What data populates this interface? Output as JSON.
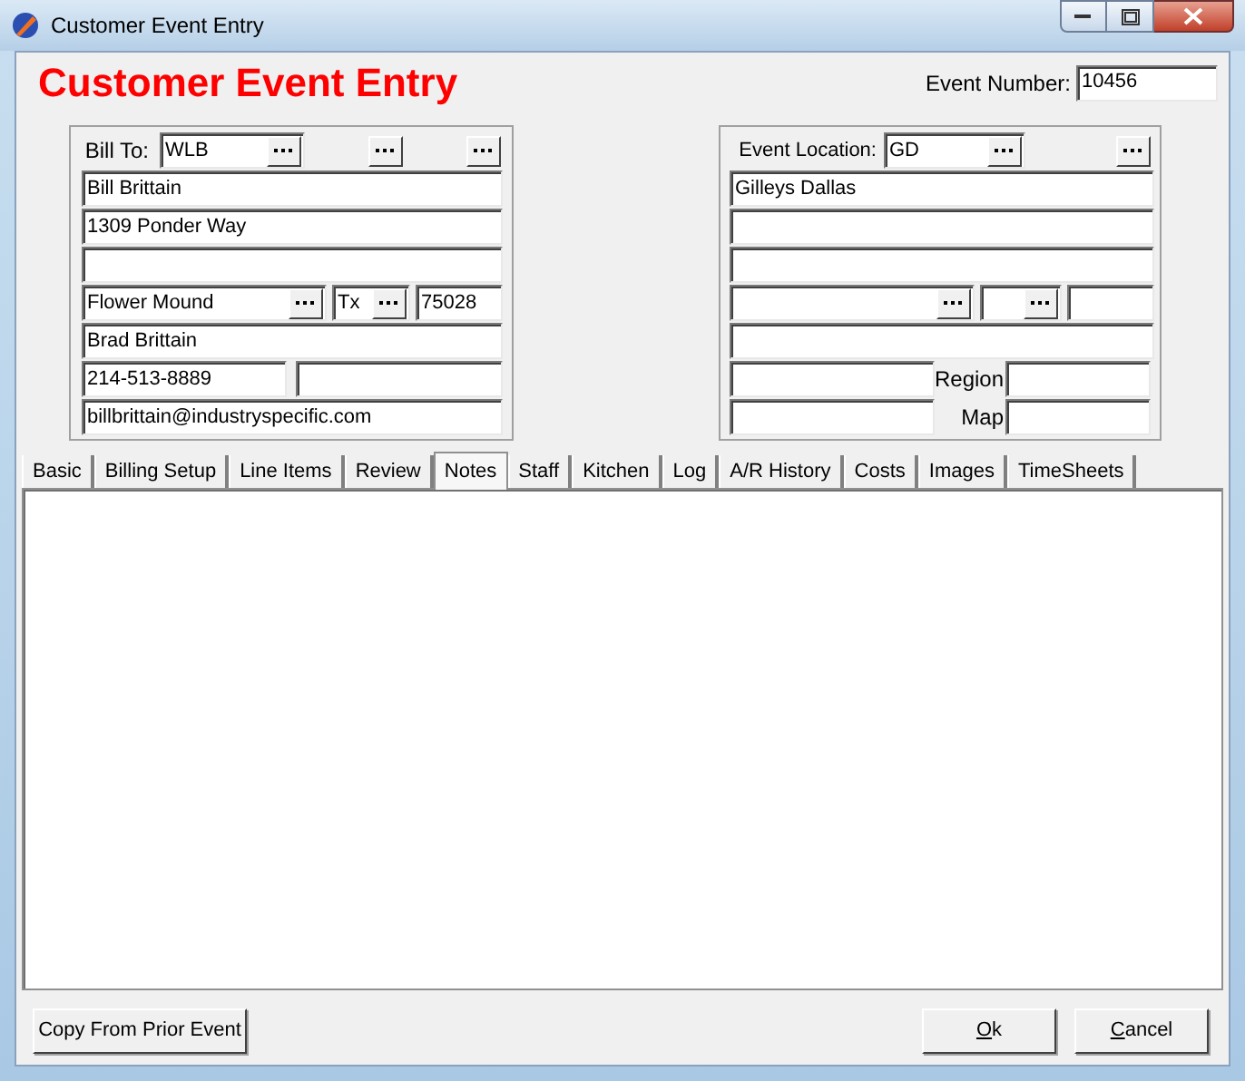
{
  "window": {
    "title": "Customer Event Entry"
  },
  "header": {
    "title": "Customer Event Entry",
    "event_number_label": "Event Number:",
    "event_number": "10456"
  },
  "bill_to": {
    "label": "Bill To:",
    "code": "WLB",
    "name": "Bill Brittain",
    "address": "1309 Ponder Way",
    "city": "Flower Mound",
    "state": "Tx",
    "zip": "75028",
    "contact": "Brad Brittain",
    "phone": "214-513-8889",
    "email": "billbrittain@industryspecific.com"
  },
  "event_location": {
    "label": "Event Location:",
    "code": "GD",
    "name": "Gilleys Dallas",
    "region_label": "Region",
    "map_label": "Map"
  },
  "tabs": [
    {
      "label": "Basic",
      "selected": false
    },
    {
      "label": "Billing Setup",
      "selected": false
    },
    {
      "label": "Line Items",
      "selected": false
    },
    {
      "label": "Review",
      "selected": false
    },
    {
      "label": "Notes",
      "selected": true
    },
    {
      "label": "Staff",
      "selected": false
    },
    {
      "label": "Kitchen",
      "selected": false
    },
    {
      "label": "Log",
      "selected": false
    },
    {
      "label": "A/R History",
      "selected": false
    },
    {
      "label": "Costs",
      "selected": false
    },
    {
      "label": "Images",
      "selected": false
    },
    {
      "label": "TimeSheets",
      "selected": false
    }
  ],
  "buttons": {
    "copy": "Copy From Prior Event",
    "ok": "Ok",
    "cancel": "Cancel"
  }
}
